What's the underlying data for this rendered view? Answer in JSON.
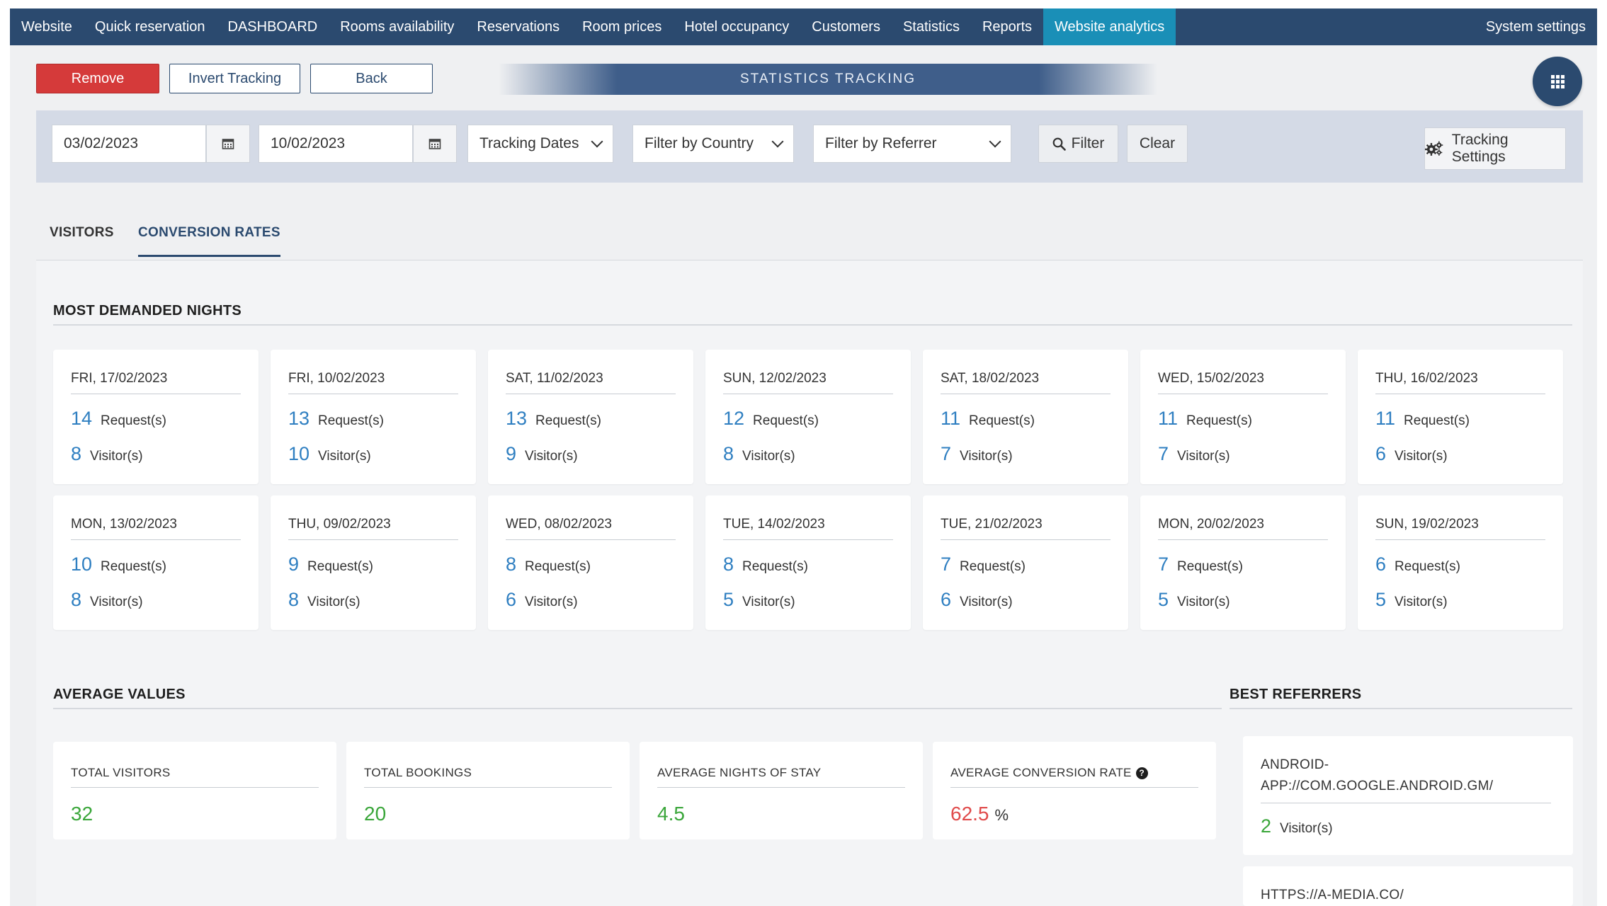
{
  "nav": {
    "items": [
      "Website",
      "Quick reservation",
      "DASHBOARD",
      "Rooms availability",
      "Reservations",
      "Room prices",
      "Hotel occupancy",
      "Customers",
      "Statistics",
      "Reports",
      "Website analytics"
    ],
    "active": "Website analytics",
    "right": "System settings"
  },
  "toolbar": {
    "remove_label": "Remove",
    "invert_label": "Invert Tracking",
    "back_label": "Back",
    "banner": "STATISTICS TRACKING"
  },
  "filters": {
    "date_from": "03/02/2023",
    "date_to": "10/02/2023",
    "tracking_dates": "Tracking Dates",
    "country": "Filter by Country",
    "referrer": "Filter by Referrer",
    "filter_label": "Filter",
    "clear_label": "Clear",
    "settings_label": "Tracking Settings"
  },
  "tabs": {
    "visitors": "VISITORS",
    "conversion": "CONVERSION RATES"
  },
  "nights": {
    "title": "MOST DEMANDED NIGHTS",
    "request_label": "Request(s)",
    "visitor_label": "Visitor(s)",
    "cards": [
      {
        "date": "FRI, 17/02/2023",
        "requests": "14",
        "visitors": "8"
      },
      {
        "date": "FRI, 10/02/2023",
        "requests": "13",
        "visitors": "10"
      },
      {
        "date": "SAT, 11/02/2023",
        "requests": "13",
        "visitors": "9"
      },
      {
        "date": "SUN, 12/02/2023",
        "requests": "12",
        "visitors": "8"
      },
      {
        "date": "SAT, 18/02/2023",
        "requests": "11",
        "visitors": "7"
      },
      {
        "date": "WED, 15/02/2023",
        "requests": "11",
        "visitors": "7"
      },
      {
        "date": "THU, 16/02/2023",
        "requests": "11",
        "visitors": "6"
      },
      {
        "date": "MON, 13/02/2023",
        "requests": "10",
        "visitors": "8"
      },
      {
        "date": "THU, 09/02/2023",
        "requests": "9",
        "visitors": "8"
      },
      {
        "date": "WED, 08/02/2023",
        "requests": "8",
        "visitors": "6"
      },
      {
        "date": "TUE, 14/02/2023",
        "requests": "8",
        "visitors": "5"
      },
      {
        "date": "TUE, 21/02/2023",
        "requests": "7",
        "visitors": "6"
      },
      {
        "date": "MON, 20/02/2023",
        "requests": "7",
        "visitors": "5"
      },
      {
        "date": "SUN, 19/02/2023",
        "requests": "6",
        "visitors": "5"
      }
    ]
  },
  "averages": {
    "title": "AVERAGE VALUES",
    "total_visitors_label": "TOTAL VISITORS",
    "total_visitors": "32",
    "total_bookings_label": "TOTAL BOOKINGS",
    "total_bookings": "20",
    "avg_nights_label": "AVERAGE NIGHTS OF STAY",
    "avg_nights": "4.5",
    "avg_conv_label": "AVERAGE CONVERSION RATE",
    "avg_conv": "62.5",
    "avg_conv_unit": "%"
  },
  "referrers": {
    "title": "BEST REFERRERS",
    "visitor_label": "Visitor(s)",
    "items": [
      {
        "name": "ANDROID-APP://COM.GOOGLE.ANDROID.GM/",
        "visitors": "2"
      },
      {
        "name": "HTTPS://A-MEDIA.CO/",
        "visitors": ""
      }
    ]
  }
}
